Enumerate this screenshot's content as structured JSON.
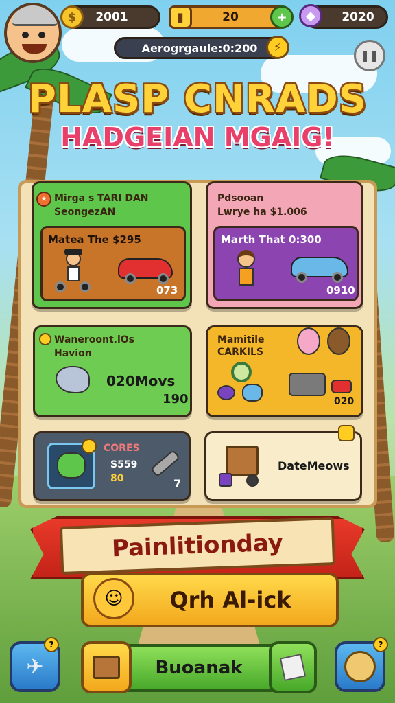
{
  "hud": {
    "coins": "2001",
    "energy": "20",
    "gems": "2020",
    "timer": "Aerogrgaule:0:200"
  },
  "title": {
    "line1": "PLASP CNRADS",
    "line2": "HADGEIAN MGAIG!"
  },
  "cards": [
    {
      "header1": "Mirga s TARI DAN",
      "header2": "SeongezAN",
      "label": "Matea The $295",
      "value": "073",
      "color": "#5ec64a",
      "inner_color": "#c8752a"
    },
    {
      "header1": "Pdsooan",
      "header2": "Lwrye ha $1.006",
      "label": "Marth That 0:300",
      "value": "0910",
      "color": "#f3a6b6",
      "inner_color": "#8b44b0"
    },
    {
      "header1": "Waneroont.lOs",
      "header2": "Havion",
      "big": "020Movs",
      "value": "190",
      "color": "#6fcc52"
    },
    {
      "header1": "Mamitile",
      "header2": "CARKILS",
      "value": "020",
      "color": "#f5b72a"
    },
    {
      "header": "CORES",
      "line1": "S559",
      "line2": "80",
      "value": "7",
      "color": "#4d5a6a"
    },
    {
      "label": "DateMeows",
      "color": "#f8eccb"
    }
  ],
  "ribbon": {
    "label": "Painlitionday"
  },
  "quick": {
    "label": "Qrh Al-ick"
  },
  "bottom": {
    "main_label": "Buoanak",
    "badge_left": "?",
    "badge_right": "?"
  },
  "icons": {
    "pause": "pause-icon",
    "coin": "coin-icon",
    "energy": "energy-icon",
    "gem": "gem-icon"
  }
}
